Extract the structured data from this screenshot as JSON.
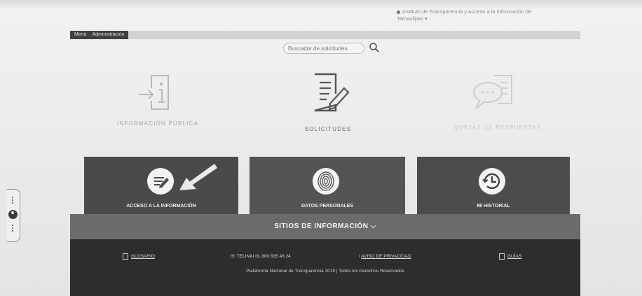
{
  "institution": "Instituto de Transparencia y Acceso a la Información de Tamaulipas",
  "menu": {
    "item_1": "Menú",
    "item_2": "Administración"
  },
  "search": {
    "placeholder": "Buscador de solicitudes"
  },
  "nav": [
    {
      "label": "INFORMACIÓN PÚBLICA",
      "icon": "document-arrow-icon"
    },
    {
      "label": "SOLICITUDES",
      "icon": "document-pencil-icon"
    },
    {
      "label": "QUEJAS DE RESPUESTAS",
      "icon": "speech-bubble-document-icon"
    }
  ],
  "panels": [
    {
      "label": "ACCESO A LA INFORMACIÓN",
      "icon": "document-edit-icon"
    },
    {
      "label": "DATOS PERSONALES",
      "icon": "fingerprint-icon"
    },
    {
      "label": "MI HISTORIAL",
      "icon": "history-clock-icon"
    }
  ],
  "sitios": {
    "label": "SITIOS DE INFORMACIÓN"
  },
  "footer": {
    "glosario": "GLOSARIO",
    "telefono": "TELINAI 01 800 835 43 24",
    "aviso": "AVISO DE PRIVACIDAD",
    "guias": "GUÍAS",
    "copyright": "Plataforma Nacional de Transparencia 2019 | Todos los Derechos Reservados"
  },
  "colors": {
    "panel_bg": "#4f4f4f",
    "footer_bg": "#2c2d2f",
    "sitios_bg": "#6b6b6b"
  }
}
